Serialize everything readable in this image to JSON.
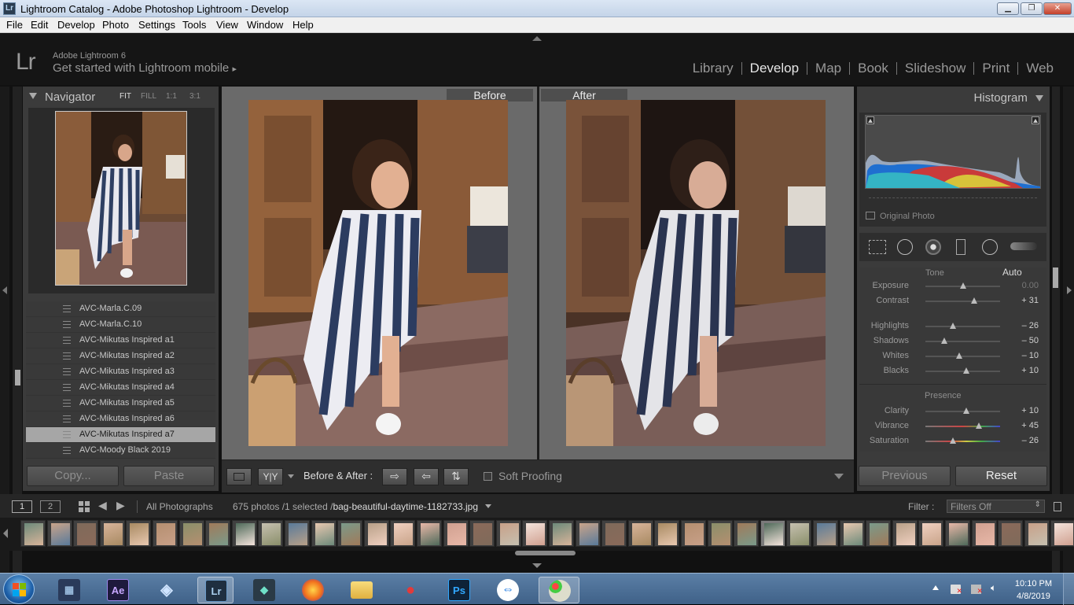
{
  "window": {
    "title": "Lightroom Catalog - Adobe Photoshop Lightroom - Develop",
    "app_icon": "Lr"
  },
  "menu": [
    "File",
    "Edit",
    "Develop",
    "Photo",
    "Settings",
    "Tools",
    "View",
    "Window",
    "Help"
  ],
  "identity": {
    "logo": "Lr",
    "product": "Adobe Lightroom 6",
    "tagline": "Get started with Lightroom mobile",
    "tagline_arrow": "▸"
  },
  "modules": [
    {
      "label": "Library",
      "active": false
    },
    {
      "label": "Develop",
      "active": true
    },
    {
      "label": "Map",
      "active": false
    },
    {
      "label": "Book",
      "active": false
    },
    {
      "label": "Slideshow",
      "active": false
    },
    {
      "label": "Print",
      "active": false
    },
    {
      "label": "Web",
      "active": false
    }
  ],
  "navigator": {
    "title": "Navigator",
    "zoom": {
      "fit": "FIT",
      "fill": "FILL",
      "one": "1:1",
      "three": "3:1"
    }
  },
  "presets": {
    "items": [
      "AVC-Marla.C.09",
      "AVC-Marla.C.10",
      "AVC-Mikutas Inspired a1",
      "AVC-Mikutas Inspired a2",
      "AVC-Mikutas Inspired a3",
      "AVC-Mikutas Inspired a4",
      "AVC-Mikutas Inspired a5",
      "AVC-Mikutas Inspired a6",
      "AVC-Mikutas Inspired a7",
      "AVC-Moody Black 2019"
    ],
    "selected_index": 8
  },
  "left_buttons": {
    "copy": "Copy...",
    "paste": "Paste"
  },
  "compare": {
    "before": "Before",
    "after": "After"
  },
  "toolbar": {
    "yy": "Y|Y",
    "ba_label": "Before & After :",
    "soft_proofing": "Soft Proofing"
  },
  "histogram": {
    "title": "Histogram",
    "original_photo": "Original Photo"
  },
  "basic": {
    "tone_label": "Tone",
    "auto_label": "Auto",
    "presence_label": "Presence",
    "tone_sliders": [
      {
        "label": "Exposure",
        "value": "0.00",
        "pos": 0.5
      },
      {
        "label": "Contrast",
        "value": "+ 31",
        "pos": 0.65
      }
    ],
    "tone_sliders2": [
      {
        "label": "Highlights",
        "value": "– 26",
        "pos": 0.37
      },
      {
        "label": "Shadows",
        "value": "– 50",
        "pos": 0.25
      },
      {
        "label": "Whites",
        "value": "– 10",
        "pos": 0.45
      },
      {
        "label": "Blacks",
        "value": "+ 10",
        "pos": 0.55
      }
    ],
    "presence_sliders": [
      {
        "label": "Clarity",
        "value": "+ 10",
        "pos": 0.55
      },
      {
        "label": "Vibrance",
        "value": "+ 45",
        "pos": 0.72
      },
      {
        "label": "Saturation",
        "value": "– 26",
        "pos": 0.37
      }
    ]
  },
  "right_buttons": {
    "previous": "Previous",
    "reset": "Reset"
  },
  "filmbar": {
    "page1": "1",
    "page2": "2",
    "source": "All Photographs",
    "count": "675 photos /1 selected /",
    "filename": "bag-beautiful-daytime-1182733.jpg",
    "filter_label": "Filter :",
    "filter_value": "Filters Off"
  },
  "taskbar": {
    "time": "10:10 PM",
    "date": "4/8/2019"
  }
}
